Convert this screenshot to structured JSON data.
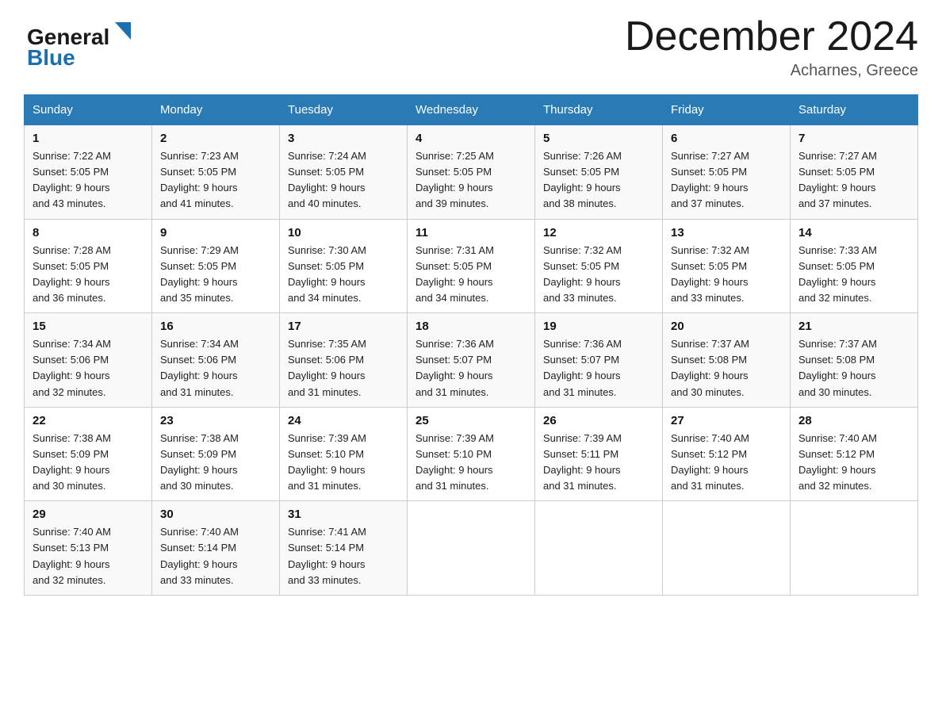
{
  "header": {
    "logo_general": "General",
    "logo_blue": "Blue",
    "month_title": "December 2024",
    "location": "Acharnes, Greece"
  },
  "days_of_week": [
    "Sunday",
    "Monday",
    "Tuesday",
    "Wednesday",
    "Thursday",
    "Friday",
    "Saturday"
  ],
  "weeks": [
    [
      {
        "day": "1",
        "sunrise": "7:22 AM",
        "sunset": "5:05 PM",
        "daylight": "9 hours and 43 minutes."
      },
      {
        "day": "2",
        "sunrise": "7:23 AM",
        "sunset": "5:05 PM",
        "daylight": "9 hours and 41 minutes."
      },
      {
        "day": "3",
        "sunrise": "7:24 AM",
        "sunset": "5:05 PM",
        "daylight": "9 hours and 40 minutes."
      },
      {
        "day": "4",
        "sunrise": "7:25 AM",
        "sunset": "5:05 PM",
        "daylight": "9 hours and 39 minutes."
      },
      {
        "day": "5",
        "sunrise": "7:26 AM",
        "sunset": "5:05 PM",
        "daylight": "9 hours and 38 minutes."
      },
      {
        "day": "6",
        "sunrise": "7:27 AM",
        "sunset": "5:05 PM",
        "daylight": "9 hours and 37 minutes."
      },
      {
        "day": "7",
        "sunrise": "7:27 AM",
        "sunset": "5:05 PM",
        "daylight": "9 hours and 37 minutes."
      }
    ],
    [
      {
        "day": "8",
        "sunrise": "7:28 AM",
        "sunset": "5:05 PM",
        "daylight": "9 hours and 36 minutes."
      },
      {
        "day": "9",
        "sunrise": "7:29 AM",
        "sunset": "5:05 PM",
        "daylight": "9 hours and 35 minutes."
      },
      {
        "day": "10",
        "sunrise": "7:30 AM",
        "sunset": "5:05 PM",
        "daylight": "9 hours and 34 minutes."
      },
      {
        "day": "11",
        "sunrise": "7:31 AM",
        "sunset": "5:05 PM",
        "daylight": "9 hours and 34 minutes."
      },
      {
        "day": "12",
        "sunrise": "7:32 AM",
        "sunset": "5:05 PM",
        "daylight": "9 hours and 33 minutes."
      },
      {
        "day": "13",
        "sunrise": "7:32 AM",
        "sunset": "5:05 PM",
        "daylight": "9 hours and 33 minutes."
      },
      {
        "day": "14",
        "sunrise": "7:33 AM",
        "sunset": "5:05 PM",
        "daylight": "9 hours and 32 minutes."
      }
    ],
    [
      {
        "day": "15",
        "sunrise": "7:34 AM",
        "sunset": "5:06 PM",
        "daylight": "9 hours and 32 minutes."
      },
      {
        "day": "16",
        "sunrise": "7:34 AM",
        "sunset": "5:06 PM",
        "daylight": "9 hours and 31 minutes."
      },
      {
        "day": "17",
        "sunrise": "7:35 AM",
        "sunset": "5:06 PM",
        "daylight": "9 hours and 31 minutes."
      },
      {
        "day": "18",
        "sunrise": "7:36 AM",
        "sunset": "5:07 PM",
        "daylight": "9 hours and 31 minutes."
      },
      {
        "day": "19",
        "sunrise": "7:36 AM",
        "sunset": "5:07 PM",
        "daylight": "9 hours and 31 minutes."
      },
      {
        "day": "20",
        "sunrise": "7:37 AM",
        "sunset": "5:08 PM",
        "daylight": "9 hours and 30 minutes."
      },
      {
        "day": "21",
        "sunrise": "7:37 AM",
        "sunset": "5:08 PM",
        "daylight": "9 hours and 30 minutes."
      }
    ],
    [
      {
        "day": "22",
        "sunrise": "7:38 AM",
        "sunset": "5:09 PM",
        "daylight": "9 hours and 30 minutes."
      },
      {
        "day": "23",
        "sunrise": "7:38 AM",
        "sunset": "5:09 PM",
        "daylight": "9 hours and 30 minutes."
      },
      {
        "day": "24",
        "sunrise": "7:39 AM",
        "sunset": "5:10 PM",
        "daylight": "9 hours and 31 minutes."
      },
      {
        "day": "25",
        "sunrise": "7:39 AM",
        "sunset": "5:10 PM",
        "daylight": "9 hours and 31 minutes."
      },
      {
        "day": "26",
        "sunrise": "7:39 AM",
        "sunset": "5:11 PM",
        "daylight": "9 hours and 31 minutes."
      },
      {
        "day": "27",
        "sunrise": "7:40 AM",
        "sunset": "5:12 PM",
        "daylight": "9 hours and 31 minutes."
      },
      {
        "day": "28",
        "sunrise": "7:40 AM",
        "sunset": "5:12 PM",
        "daylight": "9 hours and 32 minutes."
      }
    ],
    [
      {
        "day": "29",
        "sunrise": "7:40 AM",
        "sunset": "5:13 PM",
        "daylight": "9 hours and 32 minutes."
      },
      {
        "day": "30",
        "sunrise": "7:40 AM",
        "sunset": "5:14 PM",
        "daylight": "9 hours and 33 minutes."
      },
      {
        "day": "31",
        "sunrise": "7:41 AM",
        "sunset": "5:14 PM",
        "daylight": "9 hours and 33 minutes."
      },
      null,
      null,
      null,
      null
    ]
  ],
  "labels": {
    "sunrise": "Sunrise:",
    "sunset": "Sunset:",
    "daylight": "Daylight:"
  }
}
